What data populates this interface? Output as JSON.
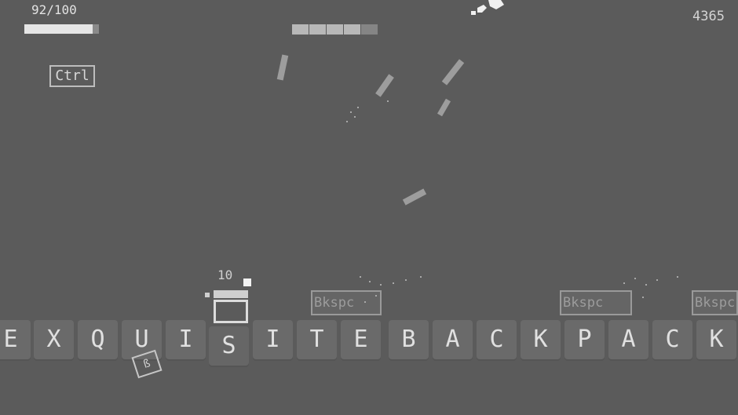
{
  "hud": {
    "health_text": "92/100",
    "health": 0.92,
    "score": "4365",
    "ammo": "10",
    "segment_bar": {
      "filled": 4,
      "total": 5
    }
  },
  "powerups": {
    "ctrl_label": "Ctrl",
    "tilted_key_label": "ß"
  },
  "enemies": [
    {
      "label": "Bkspc"
    },
    {
      "label": "Bkspc"
    },
    {
      "label": "Bkspc"
    }
  ],
  "keyboard": {
    "keys": [
      "E",
      "X",
      "Q",
      "U",
      "I",
      "S",
      "I",
      "T",
      "E",
      "B",
      "A",
      "C",
      "K",
      "P",
      "A",
      "C",
      "K"
    ]
  },
  "colors": {
    "background": "#5b5b5b",
    "key": "#6a6a6a",
    "text": "#e0e0e0"
  }
}
